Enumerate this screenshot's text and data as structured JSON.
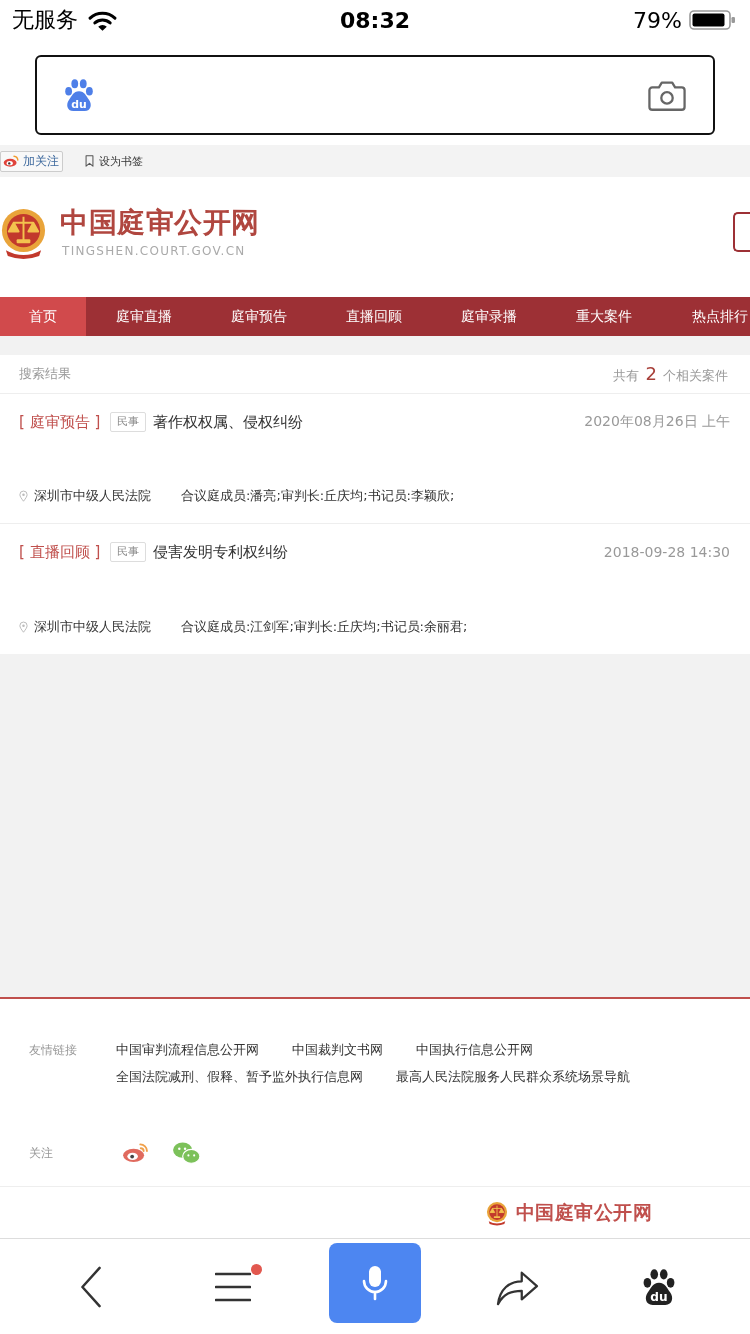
{
  "status_bar": {
    "carrier": "无服务",
    "time": "08:32",
    "battery": "79%"
  },
  "search_bar": {
    "logo_text": "du"
  },
  "top_bar": {
    "follow_button": "加关注",
    "bookmark_link": "设为书签"
  },
  "site_header": {
    "title": "中国庭审公开网",
    "subtitle": "TINGSHEN.COURT.GOV.CN"
  },
  "nav_tabs": [
    {
      "label": "首页",
      "selected": true
    },
    {
      "label": "庭审直播",
      "selected": false
    },
    {
      "label": "庭审预告",
      "selected": false
    },
    {
      "label": "直播回顾",
      "selected": false
    },
    {
      "label": "庭审录播",
      "selected": false
    },
    {
      "label": "重大案件",
      "selected": false
    },
    {
      "label": "热点排行",
      "selected": false
    }
  ],
  "results": {
    "heading": "搜索结果",
    "count_text": "共有 **2** 个相关案件",
    "items": [
      {
        "category": "[ 庭审预告 ]",
        "tag": "民事",
        "title": "著作权权属、侵权纠纷",
        "time": "2020年08月26日 上午",
        "court": "深圳市中级人民法院",
        "members": "合议庭成员:潘亮;审判长:丘庆均;书记员:李颖欣;"
      },
      {
        "category": "[ 直播回顾 ]",
        "tag": "民事",
        "title": "侵害发明专利权纠纷",
        "time": "2018-09-28 14:30",
        "court": "深圳市中级人民法院",
        "members": "合议庭成员:江剑军;审判长:丘庆均;书记员:余丽君;"
      }
    ]
  },
  "footer": {
    "links_label": "友情链接",
    "links": [
      "中国审判流程信息公开网",
      "中国裁判文书网",
      "中国执行信息公开网",
      "全国法院减刑、假释、暂予监外执行信息网",
      "最高人民法院服务人民群众系统场景导航"
    ],
    "follow_label": "关注",
    "brand": "中国庭审公开网"
  },
  "bottom_bar": {
    "menu_notification": true,
    "logo_text": "du"
  }
}
